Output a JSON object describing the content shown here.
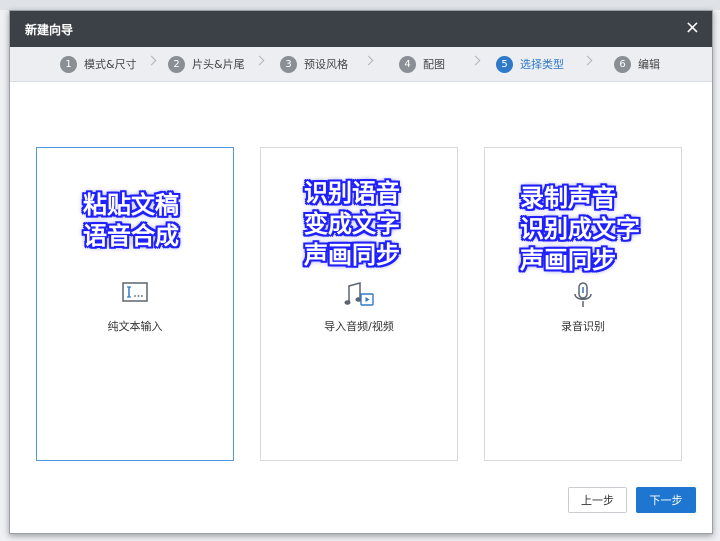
{
  "dialog": {
    "title": "新建向导",
    "close_symbol": "×"
  },
  "steps": [
    {
      "num": "1",
      "label": "模式&尺寸"
    },
    {
      "num": "2",
      "label": "片头&片尾"
    },
    {
      "num": "3",
      "label": "预设风格"
    },
    {
      "num": "4",
      "label": "配图"
    },
    {
      "num": "5",
      "label": "选择类型"
    },
    {
      "num": "6",
      "label": "编辑"
    }
  ],
  "active_step": 5,
  "options": [
    {
      "overlay": "粘贴文稿\n语音合成",
      "icon": "text-input-icon",
      "label": "纯文本输入",
      "selected": true
    },
    {
      "overlay": "识别语音\n变成文字\n声画同步",
      "icon": "music-video-icon",
      "label": "导入音频/视频",
      "selected": false
    },
    {
      "overlay": "录制声音\n识别成文字\n声画同步",
      "icon": "microphone-icon",
      "label": "录音识别",
      "selected": false
    }
  ],
  "buttons": {
    "prev": "上一步",
    "next": "下一步"
  },
  "colors": {
    "accent": "#1e76d0",
    "titlebar": "#3c4148",
    "overlay_text_outline": "#2020ff"
  }
}
